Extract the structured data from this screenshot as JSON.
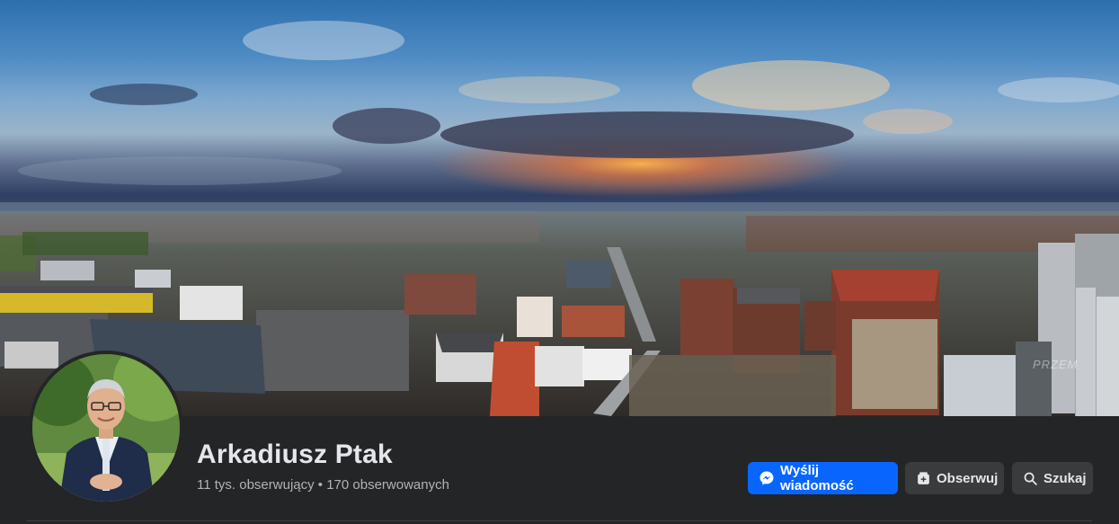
{
  "profile": {
    "name": "Arkadiusz Ptak",
    "stats": "11 tys. obserwujący • 170 obserwowanych"
  },
  "actions": {
    "message_label": "Wyślij wiadomość",
    "follow_label": "Obserwuj",
    "search_label": "Szukaj"
  },
  "icons": {
    "message": "messenger-icon",
    "follow": "follow-icon",
    "search": "search-icon"
  },
  "colors": {
    "background": "#242526",
    "primary_button": "#0866ff",
    "secondary_button": "#3a3b3c",
    "text_primary": "#e4e6eb",
    "text_secondary": "#b0b3b8"
  }
}
